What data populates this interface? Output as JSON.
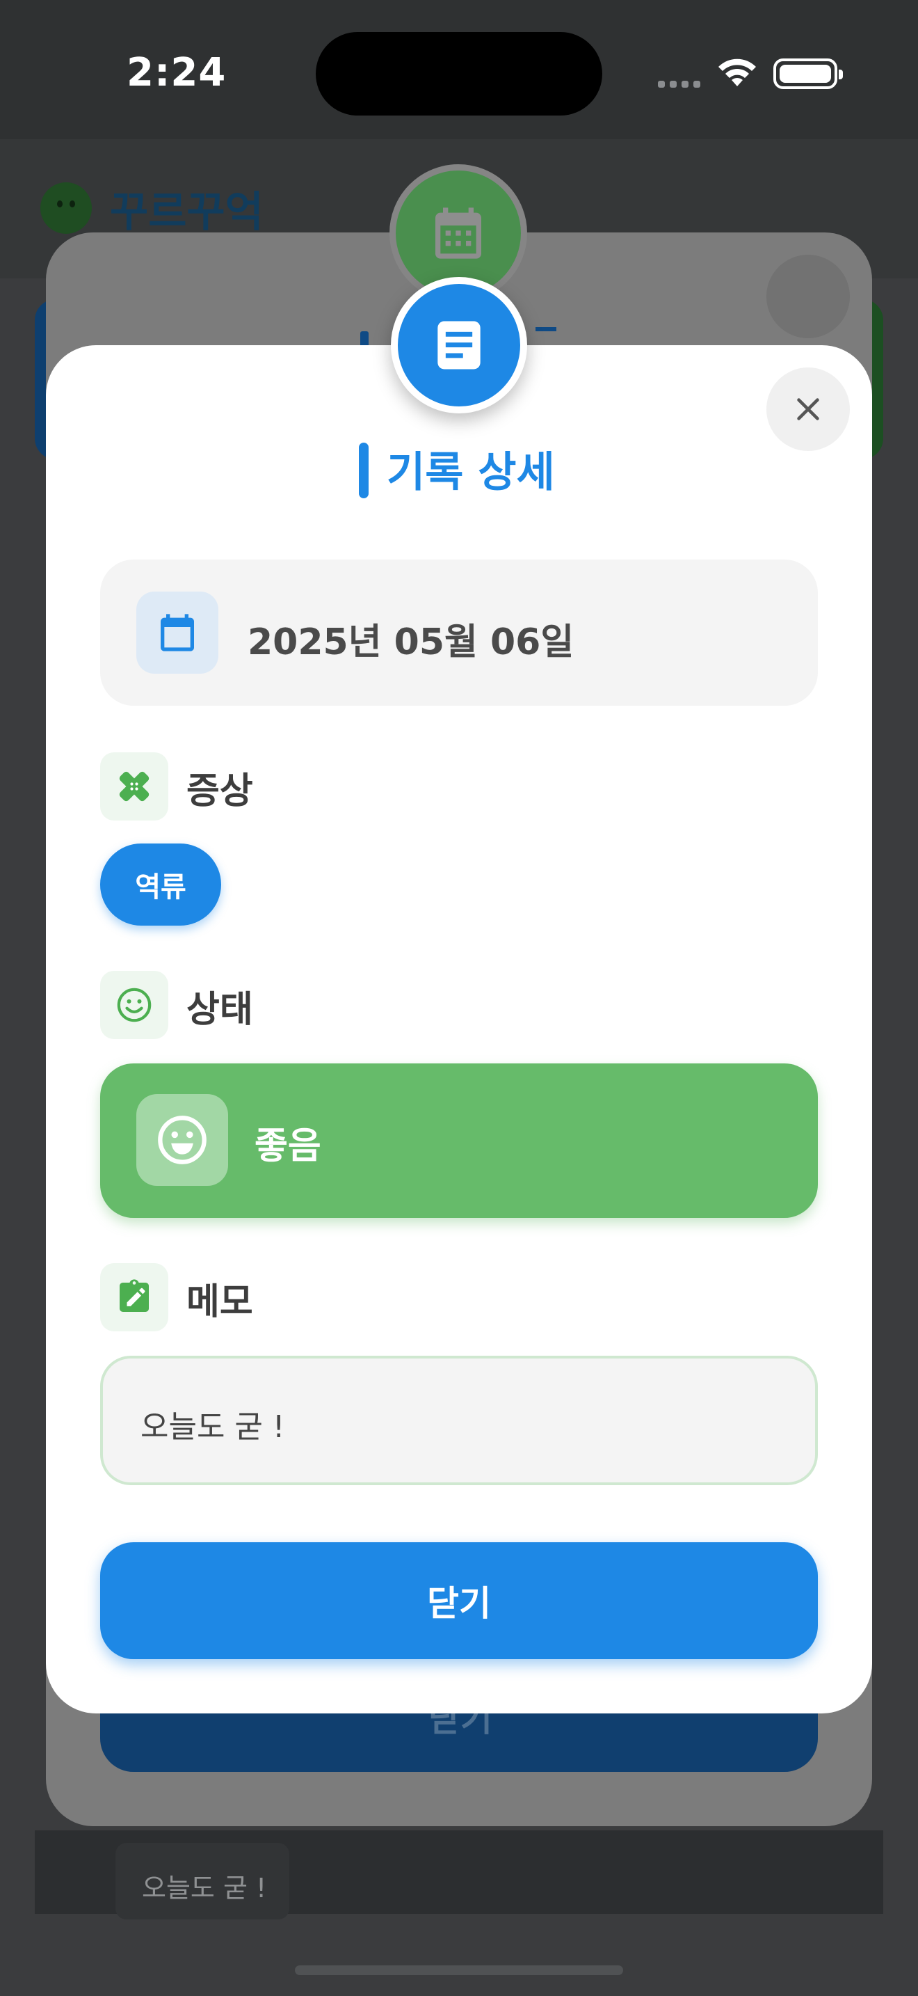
{
  "status_bar": {
    "time": "2:24"
  },
  "background_app": {
    "title": "꾸르꾸억",
    "memo_preview": "오늘도 굳 !"
  },
  "dialog": {
    "title": "기록 상세",
    "date": "2025년 05월 06일",
    "symptoms_label": "증상",
    "symptom_chips": [
      "역류"
    ],
    "status_label": "상태",
    "status_value": "좋음",
    "memo_label": "메모",
    "memo_value": "오늘도 굳 !",
    "close_button_label": "닫기"
  },
  "back_dialog": {
    "close_button_label": "닫기"
  },
  "colors": {
    "primary_blue": "#1e88e5",
    "status_green": "#66bb6a",
    "icon_green": "#4caf50"
  },
  "icons": {
    "badge": "document-icon",
    "back_badge": "calendar-icon",
    "date": "calendar-icon",
    "symptoms": "bandage-icon",
    "status": "smile-icon",
    "memo": "clipboard-edit-icon",
    "close": "close-icon"
  }
}
